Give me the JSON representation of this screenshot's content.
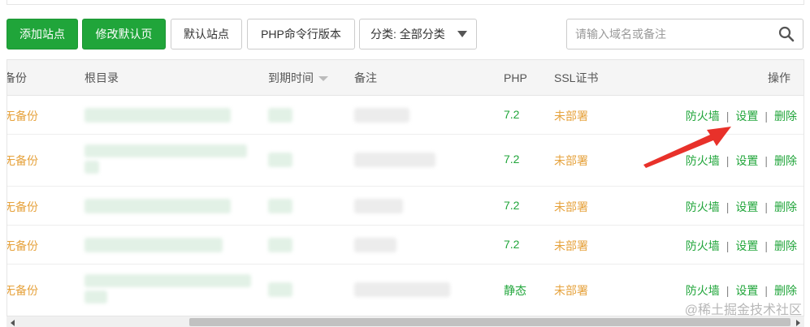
{
  "toolbar": {
    "add_site": "添加站点",
    "modify_default": "修改默认页",
    "default_site": "默认站点",
    "php_cli": "PHP命令行版本",
    "category": "分类: 全部分类"
  },
  "search": {
    "placeholder": "请输入域名或备注"
  },
  "table": {
    "headers": {
      "backup": "备份",
      "root": "根目录",
      "expire": "到期时间",
      "note": "备注",
      "php": "PHP",
      "ssl": "SSL证书",
      "actions": "操作"
    },
    "rows": [
      {
        "backup": "无备份",
        "php": "7.2",
        "ssl": "未部署",
        "op_firewall": "防火墙",
        "op_settings": "设置",
        "op_delete": "删除"
      },
      {
        "backup": "无备份",
        "php": "7.2",
        "ssl": "未部署",
        "op_firewall": "防火墙",
        "op_settings": "设置",
        "op_delete": "删除"
      },
      {
        "backup": "无备份",
        "php": "7.2",
        "ssl": "未部署",
        "op_firewall": "防火墙",
        "op_settings": "设置",
        "op_delete": "删除"
      },
      {
        "backup": "无备份",
        "php": "7.2",
        "ssl": "未部署",
        "op_firewall": "防火墙",
        "op_settings": "设置",
        "op_delete": "删除"
      },
      {
        "backup": "无备份",
        "php": "静态",
        "ssl": "未部署",
        "op_firewall": "防火墙",
        "op_settings": "设置",
        "op_delete": "删除"
      }
    ]
  },
  "watermark": "@稀土掘金技术社区",
  "colors": {
    "brand_green": "#20a53a",
    "warning_orange": "#e6a23c",
    "annotation_red": "#e8312a"
  }
}
